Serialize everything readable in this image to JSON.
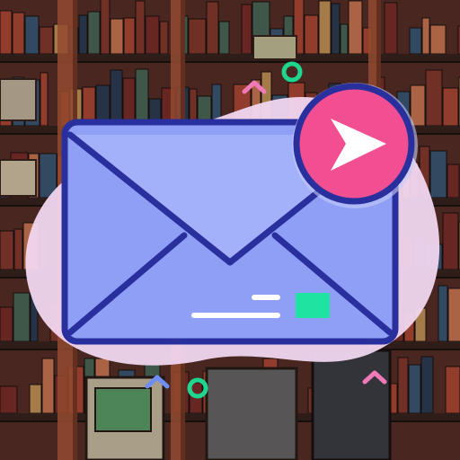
{
  "background": {
    "description_kind": "pixel-art-shelves",
    "wall_color": "#5a2f28",
    "shelf_color": "#3a2420",
    "pipe_color": "#b45a3a",
    "book_colors": [
      "#b24a35",
      "#d07a55",
      "#3f5a78",
      "#8a3b2e",
      "#c9965a",
      "#4d6b5a",
      "#7e2f2a",
      "#2f3e55"
    ],
    "monitor_screen_color": "#5fa36a"
  },
  "icon": {
    "name": "send-mail-icon",
    "envelope_fill": "#8e9ff5",
    "envelope_flap_fill": "#a3b0fa",
    "outline_color": "#2a2f9e",
    "blob_color": "#f1d7f0",
    "badge_fill": "#f24f93",
    "badge_arrow_color": "#ffffff",
    "stamp_color": "#1fe3a0",
    "line_color": "#ffffff"
  },
  "decorations": {
    "accent_green": "#1fd68f",
    "accent_pink": "#f07ab8",
    "accent_blue": "#6e8ef5"
  }
}
